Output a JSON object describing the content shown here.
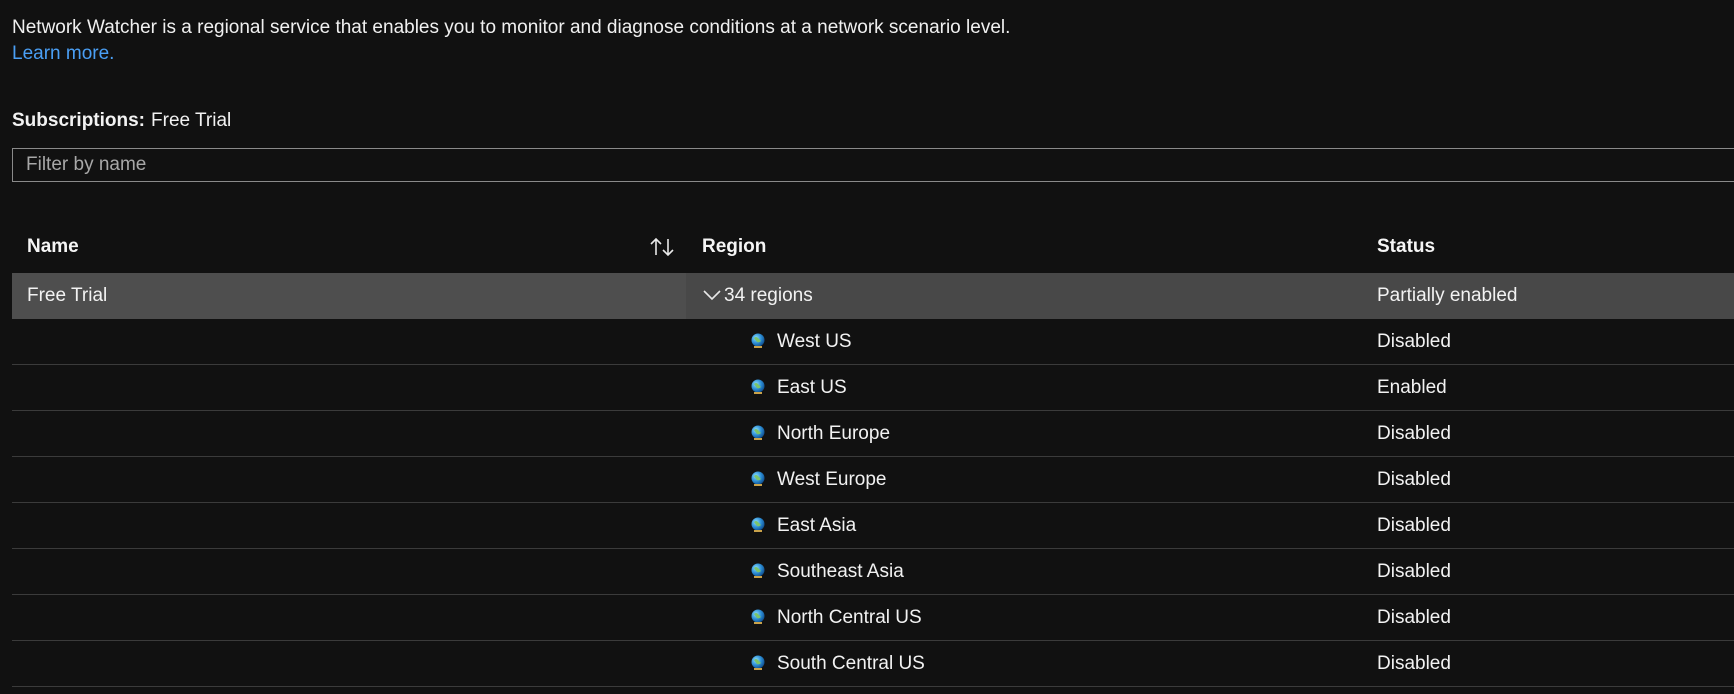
{
  "intro": {
    "text": "Network Watcher is a regional service that enables you to monitor and diagnose conditions at a network scenario level.",
    "learn_more": "Learn more."
  },
  "subscriptions": {
    "label": "Subscriptions:",
    "value": "Free Trial"
  },
  "filter": {
    "placeholder": "Filter by name",
    "value": ""
  },
  "table": {
    "columns": {
      "name": "Name",
      "region": "Region",
      "status": "Status"
    },
    "sort_icon": "sort-up-down-icon",
    "group": {
      "name": "Free Trial",
      "region_count": "34 regions",
      "status": "Partially enabled",
      "expanded": true
    },
    "rows": [
      {
        "region": "West US",
        "status": "Disabled"
      },
      {
        "region": "East US",
        "status": "Enabled"
      },
      {
        "region": "North Europe",
        "status": "Disabled"
      },
      {
        "region": "West Europe",
        "status": "Disabled"
      },
      {
        "region": "East Asia",
        "status": "Disabled"
      },
      {
        "region": "Southeast Asia",
        "status": "Disabled"
      },
      {
        "region": "North Central US",
        "status": "Disabled"
      },
      {
        "region": "South Central US",
        "status": "Disabled"
      }
    ]
  },
  "colors": {
    "background": "#111111",
    "link": "#4a9ff5",
    "group_row": "#484848",
    "divider": "#3b3b3b"
  }
}
